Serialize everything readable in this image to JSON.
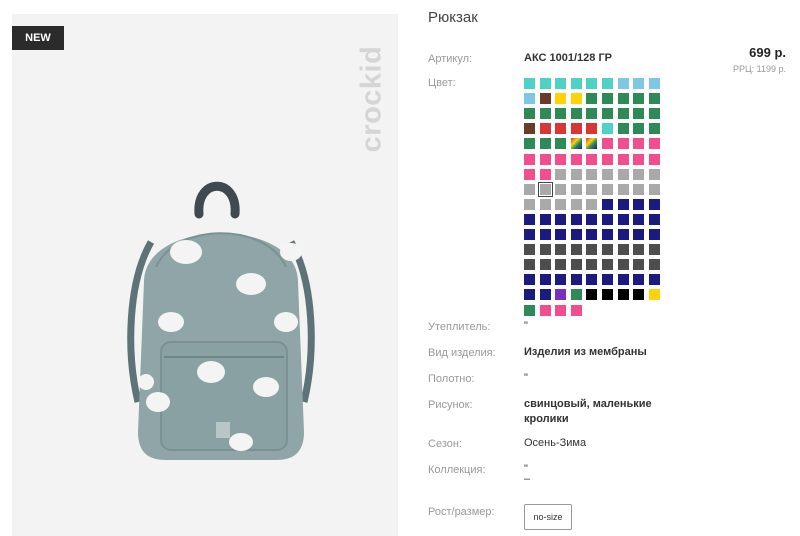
{
  "gallery": {
    "badge": "NEW",
    "brand_logo": "crockid",
    "product_image": "backpack-with-bunnies-photo"
  },
  "product": {
    "title": "Рюкзак",
    "price": "699 р.",
    "rrp": "РРЦ: 1199 р."
  },
  "attributes": {
    "article_label": "Артикул:",
    "article_value": "АКС 1001/128 ГР",
    "color_label": "Цвет:",
    "insulation_label": "Утеплитель:",
    "insulation_value": "\"",
    "type_label": "Вид изделия:",
    "type_value": "Изделия из мембраны",
    "fabric_label": "Полотно:",
    "fabric_value": "\"",
    "pattern_label": "Рисунок:",
    "pattern_value": "свинцовый, маленькие кролики",
    "season_label": "Сезон:",
    "season_value": "Осень-Зима",
    "collection_label": "Коллекция:",
    "collection_value": "\"",
    "collection_value_2": "–",
    "size_label": "Рост/размер:",
    "size_option": "no-size"
  },
  "colors": {
    "palette": [
      "#4fd1c5",
      "#7ec8e3",
      "#ffd20a",
      "#2e8b57",
      "#6b3a2a",
      "#d93636",
      "#f24e8e",
      "#a9a9a9",
      "#1a1a80",
      "#4d4d4d",
      "#1f1f8f",
      "#7b2fbe",
      "#000000"
    ],
    "grid": [
      [
        0,
        0,
        0,
        0,
        0,
        0,
        1,
        1,
        1
      ],
      [
        1,
        4,
        2,
        2,
        3,
        3,
        3,
        3,
        3
      ],
      [
        3,
        3,
        3,
        3,
        3,
        3,
        3,
        3,
        3
      ],
      [
        4,
        5,
        5,
        5,
        5,
        0,
        3,
        3,
        3
      ],
      [
        3,
        3,
        3,
        14,
        14,
        6,
        6,
        6,
        6
      ],
      [
        6,
        6,
        6,
        6,
        6,
        6,
        6,
        6,
        6
      ],
      [
        6,
        6,
        7,
        7,
        7,
        7,
        7,
        7,
        7
      ],
      [
        7,
        15,
        7,
        7,
        7,
        7,
        7,
        7,
        7
      ],
      [
        7,
        7,
        7,
        7,
        7,
        8,
        8,
        8,
        8
      ],
      [
        8,
        8,
        8,
        8,
        8,
        8,
        8,
        8,
        8
      ],
      [
        8,
        8,
        8,
        8,
        8,
        8,
        8,
        8,
        8
      ],
      [
        9,
        9,
        9,
        9,
        9,
        9,
        9,
        9,
        9
      ],
      [
        9,
        9,
        9,
        9,
        9,
        9,
        9,
        9,
        9
      ],
      [
        8,
        8,
        8,
        8,
        8,
        8,
        8,
        8,
        8
      ],
      [
        8,
        8,
        11,
        3,
        12,
        12,
        12,
        12,
        2
      ],
      [
        3,
        6,
        6,
        6
      ]
    ],
    "selected": "grey"
  }
}
